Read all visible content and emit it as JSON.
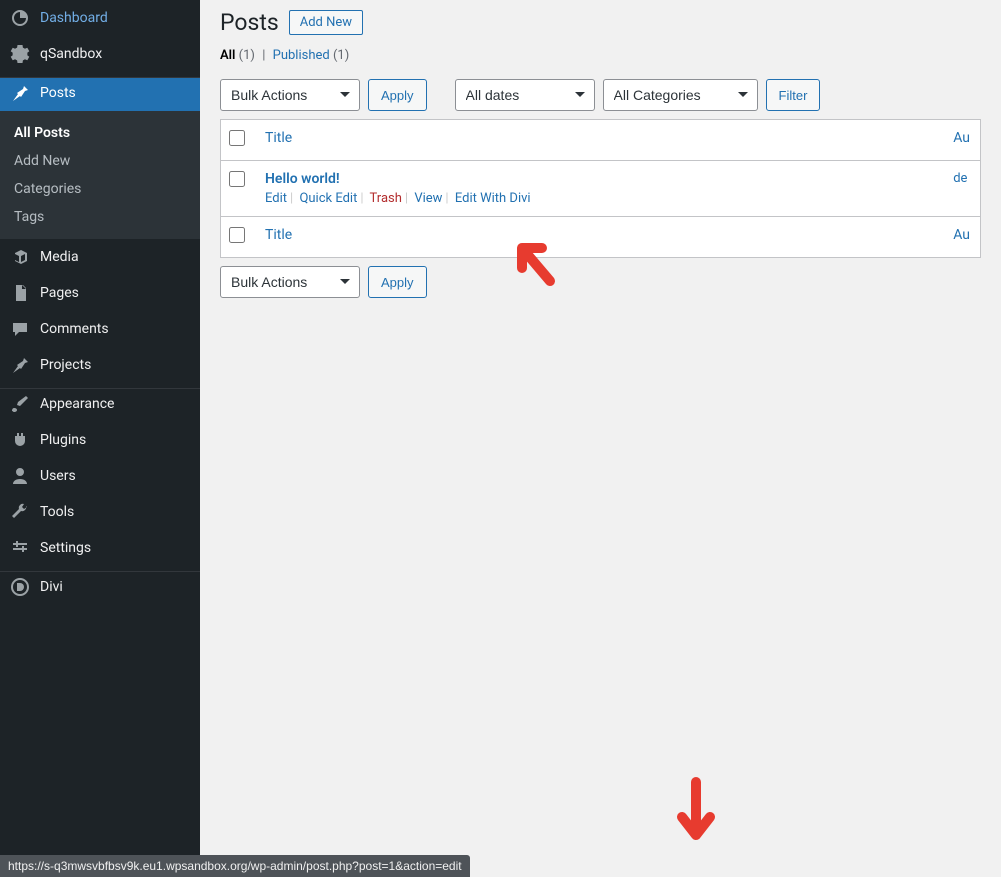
{
  "sidebar": {
    "items": [
      {
        "label": "Dashboard",
        "icon": "dashboard"
      },
      {
        "label": "qSandbox",
        "icon": "gear"
      },
      {
        "label": "Posts",
        "icon": "pin",
        "active": true
      },
      {
        "label": "Media",
        "icon": "media"
      },
      {
        "label": "Pages",
        "icon": "pages"
      },
      {
        "label": "Comments",
        "icon": "comments"
      },
      {
        "label": "Projects",
        "icon": "pin"
      },
      {
        "label": "Appearance",
        "icon": "brush"
      },
      {
        "label": "Plugins",
        "icon": "plug"
      },
      {
        "label": "Users",
        "icon": "user"
      },
      {
        "label": "Tools",
        "icon": "wrench"
      },
      {
        "label": "Settings",
        "icon": "sliders"
      },
      {
        "label": "Divi",
        "icon": "divi"
      }
    ],
    "submenu": [
      {
        "label": "All Posts",
        "current": true
      },
      {
        "label": "Add New"
      },
      {
        "label": "Categories"
      },
      {
        "label": "Tags"
      }
    ]
  },
  "header": {
    "title": "Posts",
    "action": "Add New"
  },
  "views": {
    "all_label": "All",
    "all_count": "(1)",
    "published_label": "Published",
    "published_count": "(1)"
  },
  "top_nav": {
    "bulk_label": "Bulk Actions",
    "apply_label": "Apply",
    "dates_label": "All dates",
    "cats_label": "All Categories",
    "filter_label": "Filter"
  },
  "table": {
    "col_title": "Title",
    "col_author_abbrev": "Au",
    "rows": [
      {
        "title": "Hello world!",
        "author_abbrev": "de",
        "actions": {
          "edit": "Edit",
          "quick_edit": "Quick Edit",
          "trash": "Trash",
          "view": "View",
          "edit_divi": "Edit With Divi"
        }
      }
    ]
  },
  "bottom_nav": {
    "bulk_label": "Bulk Actions",
    "apply_label": "Apply"
  },
  "status_url": "https://s-q3mwsvbfbsv9k.eu1.wpsandbox.org/wp-admin/post.php?post=1&action=edit"
}
